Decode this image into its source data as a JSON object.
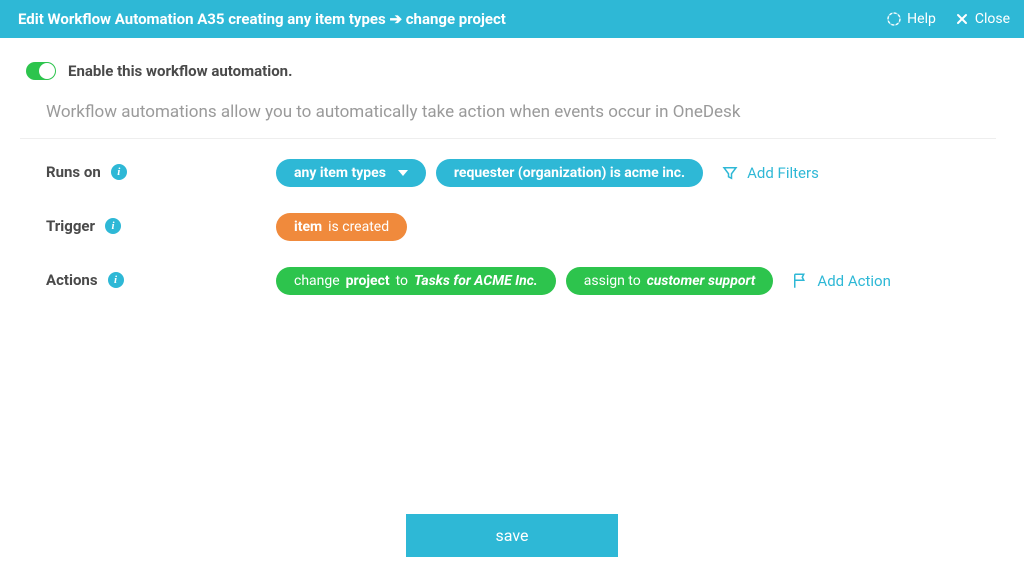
{
  "header": {
    "title": "Edit Workflow Automation A35 creating any item types ➔ change project",
    "help": "Help",
    "close": "Close"
  },
  "enable": {
    "label": "Enable this workflow automation."
  },
  "description": "Workflow automations allow you to automatically take action when events occur in OneDesk",
  "runsOn": {
    "label": "Runs on",
    "typeSelector": "any item types",
    "filter": "requester (organization) is acme inc.",
    "addFilters": "Add Filters"
  },
  "trigger": {
    "label": "Trigger",
    "item": "item",
    "verb": "is created"
  },
  "actions": {
    "label": "Actions",
    "a1_prefix": "change",
    "a1_field": "project",
    "a1_to": "to",
    "a1_value": "Tasks for ACME Inc.",
    "a2_prefix": "assign to",
    "a2_value": "customer support",
    "addAction": "Add Action"
  },
  "save": "save"
}
